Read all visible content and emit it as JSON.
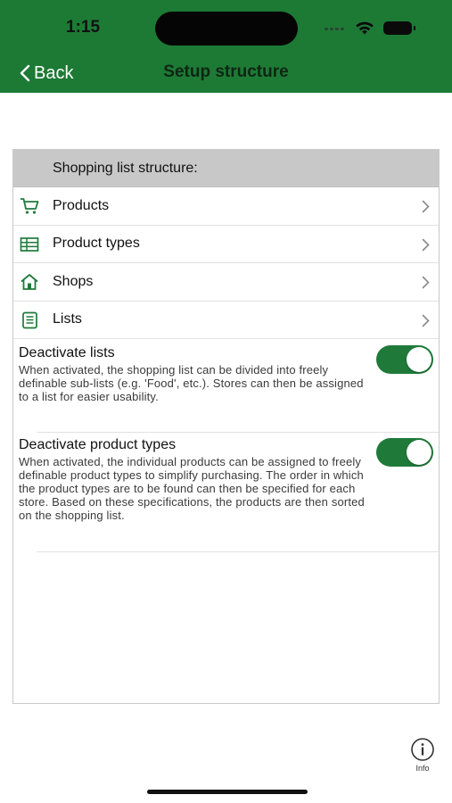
{
  "status_bar": {
    "time": "1:15"
  },
  "nav": {
    "back_label": "Back",
    "title": "Setup structure"
  },
  "section": {
    "header": "Shopping list structure:"
  },
  "rows": [
    {
      "label": "Products",
      "icon": "cart-icon"
    },
    {
      "label": "Product types",
      "icon": "table-icon"
    },
    {
      "label": "Shops",
      "icon": "house-icon"
    },
    {
      "label": "Lists",
      "icon": "list-icon"
    }
  ],
  "toggles": [
    {
      "title": "Deactivate lists",
      "description": "When activated, the shopping list can be divided into freely definable sub-lists (e.g. 'Food', etc.). Stores can then be assigned to a list for easier usability.",
      "on": true
    },
    {
      "title": "Deactivate product types",
      "description": "When activated, the individual products can be assigned to freely definable product types to simplify purchasing. The order in which the product types are to be found can then be specified for each store. Based on these specifications, the products are then sorted on the shopping list.",
      "on": true
    }
  ],
  "footer": {
    "info_label": "Info"
  },
  "colors": {
    "header": "#1d7a35",
    "toggle_on": "#1f7a3a",
    "section_header": "#c8c8c8"
  }
}
